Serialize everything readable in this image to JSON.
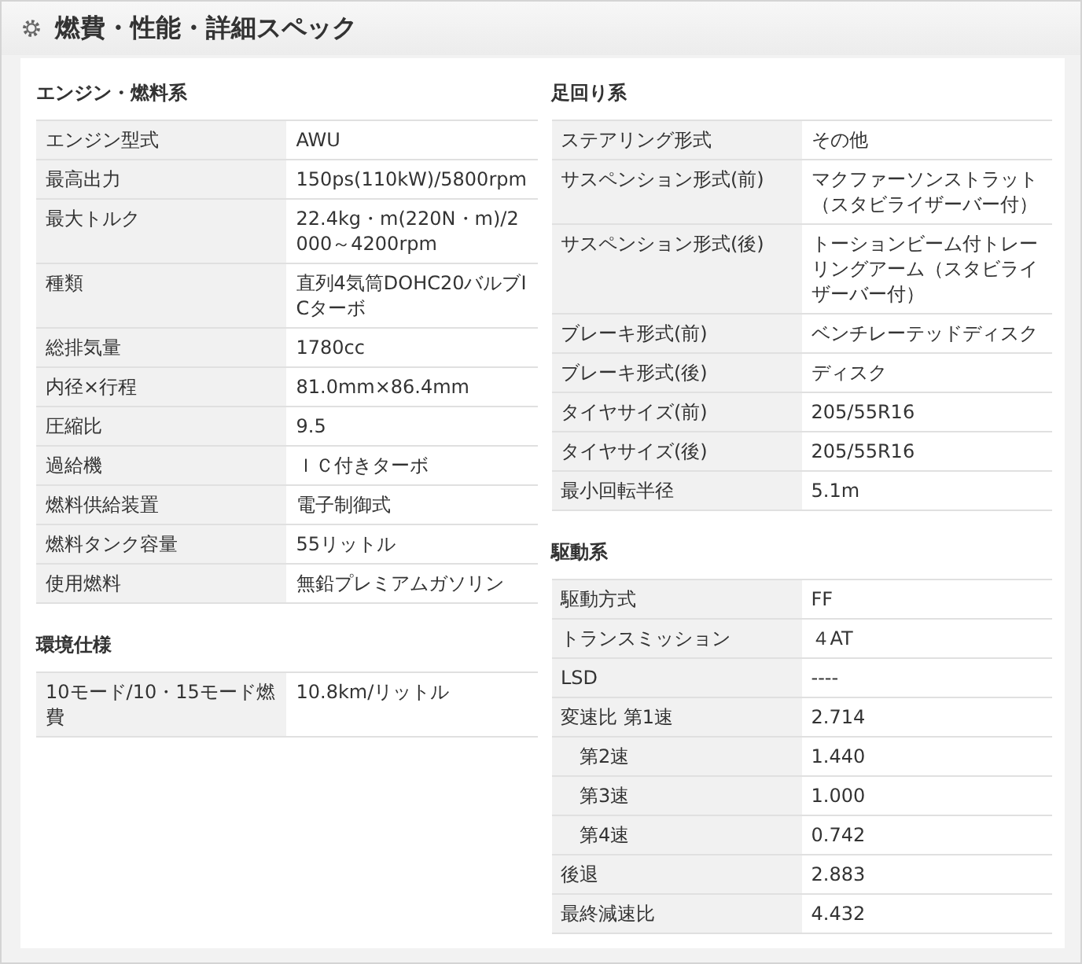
{
  "title": "燃費・性能・詳細スペック",
  "columns": [
    [
      {
        "heading": "エンジン・燃料系",
        "rows": [
          {
            "label": "エンジン型式",
            "value": "AWU"
          },
          {
            "label": "最高出力",
            "value": "150ps(110kW)/5800rpm"
          },
          {
            "label": "最大トルク",
            "value": "22.4kg・m(220N・m)/2000～4200rpm"
          },
          {
            "label": "種類",
            "value": "直列4気筒DOHC20バルブICターボ"
          },
          {
            "label": "総排気量",
            "value": "1780cc"
          },
          {
            "label": "内径×行程",
            "value": "81.0mm×86.4mm"
          },
          {
            "label": "圧縮比",
            "value": "9.5"
          },
          {
            "label": "過給機",
            "value": "ＩＣ付きターボ"
          },
          {
            "label": "燃料供給装置",
            "value": "電子制御式"
          },
          {
            "label": "燃料タンク容量",
            "value": "55リットル"
          },
          {
            "label": "使用燃料",
            "value": "無鉛プレミアムガソリン"
          }
        ]
      },
      {
        "heading": "環境仕様",
        "rows": [
          {
            "label": "10モード/10・15モード燃費",
            "value": "10.8km/リットル"
          }
        ]
      }
    ],
    [
      {
        "heading": "足回り系",
        "rows": [
          {
            "label": "ステアリング形式",
            "value": "その他"
          },
          {
            "label": "サスペンション形式(前)",
            "value": "マクファーソンストラット（スタビライザーバー付）"
          },
          {
            "label": "サスペンション形式(後)",
            "value": "トーションビーム付トレーリングアーム（スタビライザーバー付）"
          },
          {
            "label": "ブレーキ形式(前)",
            "value": "ベンチレーテッドディスク"
          },
          {
            "label": "ブレーキ形式(後)",
            "value": "ディスク"
          },
          {
            "label": "タイヤサイズ(前)",
            "value": "205/55R16"
          },
          {
            "label": "タイヤサイズ(後)",
            "value": "205/55R16"
          },
          {
            "label": "最小回転半径",
            "value": "5.1m"
          }
        ]
      },
      {
        "heading": "駆動系",
        "rows": [
          {
            "label": "駆動方式",
            "value": "FF"
          },
          {
            "label": "トランスミッション",
            "value": "４AT"
          },
          {
            "label": "LSD",
            "value": "----"
          },
          {
            "label": "変速比 第1速",
            "value": "2.714"
          },
          {
            "label": "第2速",
            "value": "1.440",
            "indent": true
          },
          {
            "label": "第3速",
            "value": "1.000",
            "indent": true
          },
          {
            "label": "第4速",
            "value": "0.742",
            "indent": true
          },
          {
            "label": "後退",
            "value": "2.883"
          },
          {
            "label": "最終減速比",
            "value": "4.432"
          }
        ]
      }
    ]
  ]
}
